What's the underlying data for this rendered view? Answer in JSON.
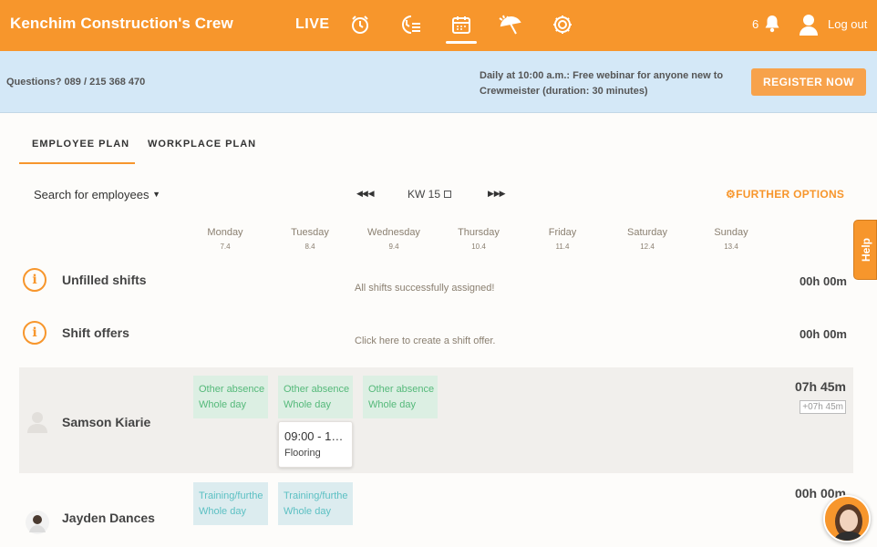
{
  "topbar": {
    "brand": "Kenchim Construction's Crew",
    "live_label": "LIVE",
    "icons": [
      "alarm-clock-icon",
      "time-list-icon",
      "calendar-icon",
      "vacation-umbrella-icon",
      "gear-icon"
    ],
    "notification_count": "6",
    "logout_label": "Log out"
  },
  "infobar": {
    "questions": "Questions? 089 / 215 368 470",
    "webinar": "Daily at 10:00 a.m.: Free webinar for anyone new to Crewmeister (duration: 30 minutes)",
    "register_label": "REGISTER NOW"
  },
  "tabs": [
    {
      "label": "EMPLOYEE PLAN",
      "active": true
    },
    {
      "label": "WORKPLACE PLAN",
      "active": false
    }
  ],
  "toolbar": {
    "search_label": "Search for employees",
    "week_label": "KW 15",
    "further_options": "FURTHER OPTIONS"
  },
  "days": [
    {
      "name": "Monday",
      "date": "7.4"
    },
    {
      "name": "Tuesday",
      "date": "8.4"
    },
    {
      "name": "Wednesday",
      "date": "9.4"
    },
    {
      "name": "Thursday",
      "date": "10.4"
    },
    {
      "name": "Friday",
      "date": "11.4"
    },
    {
      "name": "Saturday",
      "date": "12.4"
    },
    {
      "name": "Sunday",
      "date": "13.4"
    }
  ],
  "unfilled": {
    "label": "Unfilled shifts",
    "message": "All shifts successfully assigned!",
    "hours": "00h 00m"
  },
  "offers": {
    "label": "Shift offers",
    "message": "Click here to create a shift offer.",
    "hours": "00h 00m"
  },
  "employees": [
    {
      "name": "Samson Kiarie",
      "hours": "07h 45m",
      "extra": "+07h 45m",
      "cells": [
        {
          "day": "Monday",
          "line1": "Other absence",
          "line2": "Whole day"
        },
        {
          "day": "Tuesday",
          "line1": "Other absence",
          "line2": "Whole day"
        },
        {
          "day": "Wednesday",
          "line1": "Other absence",
          "line2": "Whole day"
        }
      ],
      "shift": {
        "day": "Tuesday",
        "time": "09:00 - 1…",
        "area": "Flooring"
      }
    },
    {
      "name": "Jayden Dances",
      "hours": "00h 00m",
      "cells": [
        {
          "day": "Monday",
          "line1": "Training/furthe",
          "line2": "Whole day"
        },
        {
          "day": "Tuesday",
          "line1": "Training/furthe",
          "line2": "Whole day"
        }
      ]
    }
  ],
  "help_label": "Help",
  "colors": {
    "brand_orange": "#f7962c",
    "info_blue": "#d4e8f7",
    "absence_green": "#55b97a",
    "training_teal": "#5cc0c3"
  }
}
